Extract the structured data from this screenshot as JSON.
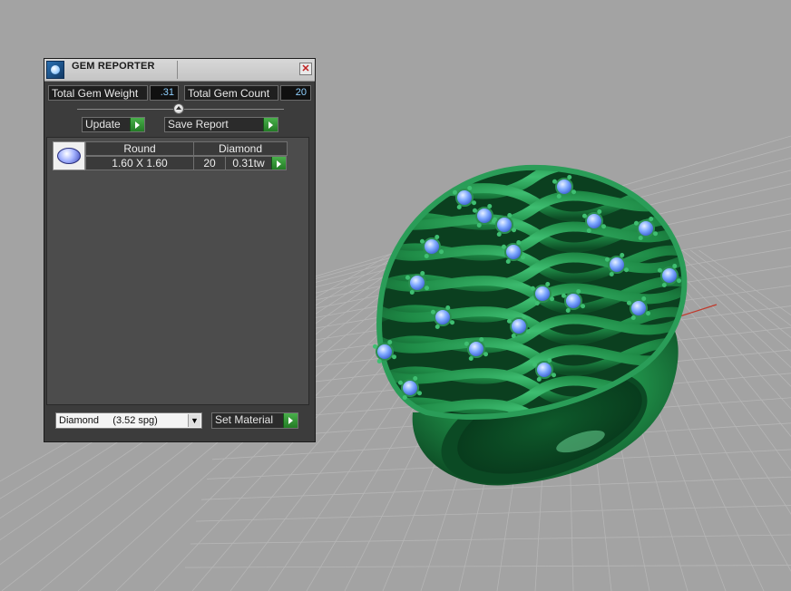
{
  "window": {
    "title": "GEM REPORTER",
    "close_glyph": "✕"
  },
  "totals": {
    "weight_label": "Total Gem Weight",
    "weight_value": ".31",
    "count_label": "Total Gem Count",
    "count_value": "20"
  },
  "actions": {
    "update_label": "Update",
    "save_report_label": "Save Report"
  },
  "gem_table": {
    "rows": [
      {
        "shape": "Round",
        "material": "Diamond",
        "size": "1.60 X 1.60",
        "count": "20",
        "weight": "0.31tw"
      }
    ]
  },
  "material": {
    "selected": "Diamond     (3.52 spg)",
    "set_label": "Set Material"
  },
  "colors": {
    "ring_metal": "#1f8c47",
    "gem_blue": "#6fa3ff",
    "viewport_bg": "#a3a3a3",
    "panel_bg": "#3c3c3c",
    "accent_green": "#2f9a34",
    "value_text": "#8fd0ff"
  },
  "icons": [
    "gem-reporter-app-icon",
    "close-icon",
    "slider-knob-icon",
    "play-arrow-icon",
    "round-gem-thumbnail-icon",
    "dropdown-arrow-icon"
  ]
}
